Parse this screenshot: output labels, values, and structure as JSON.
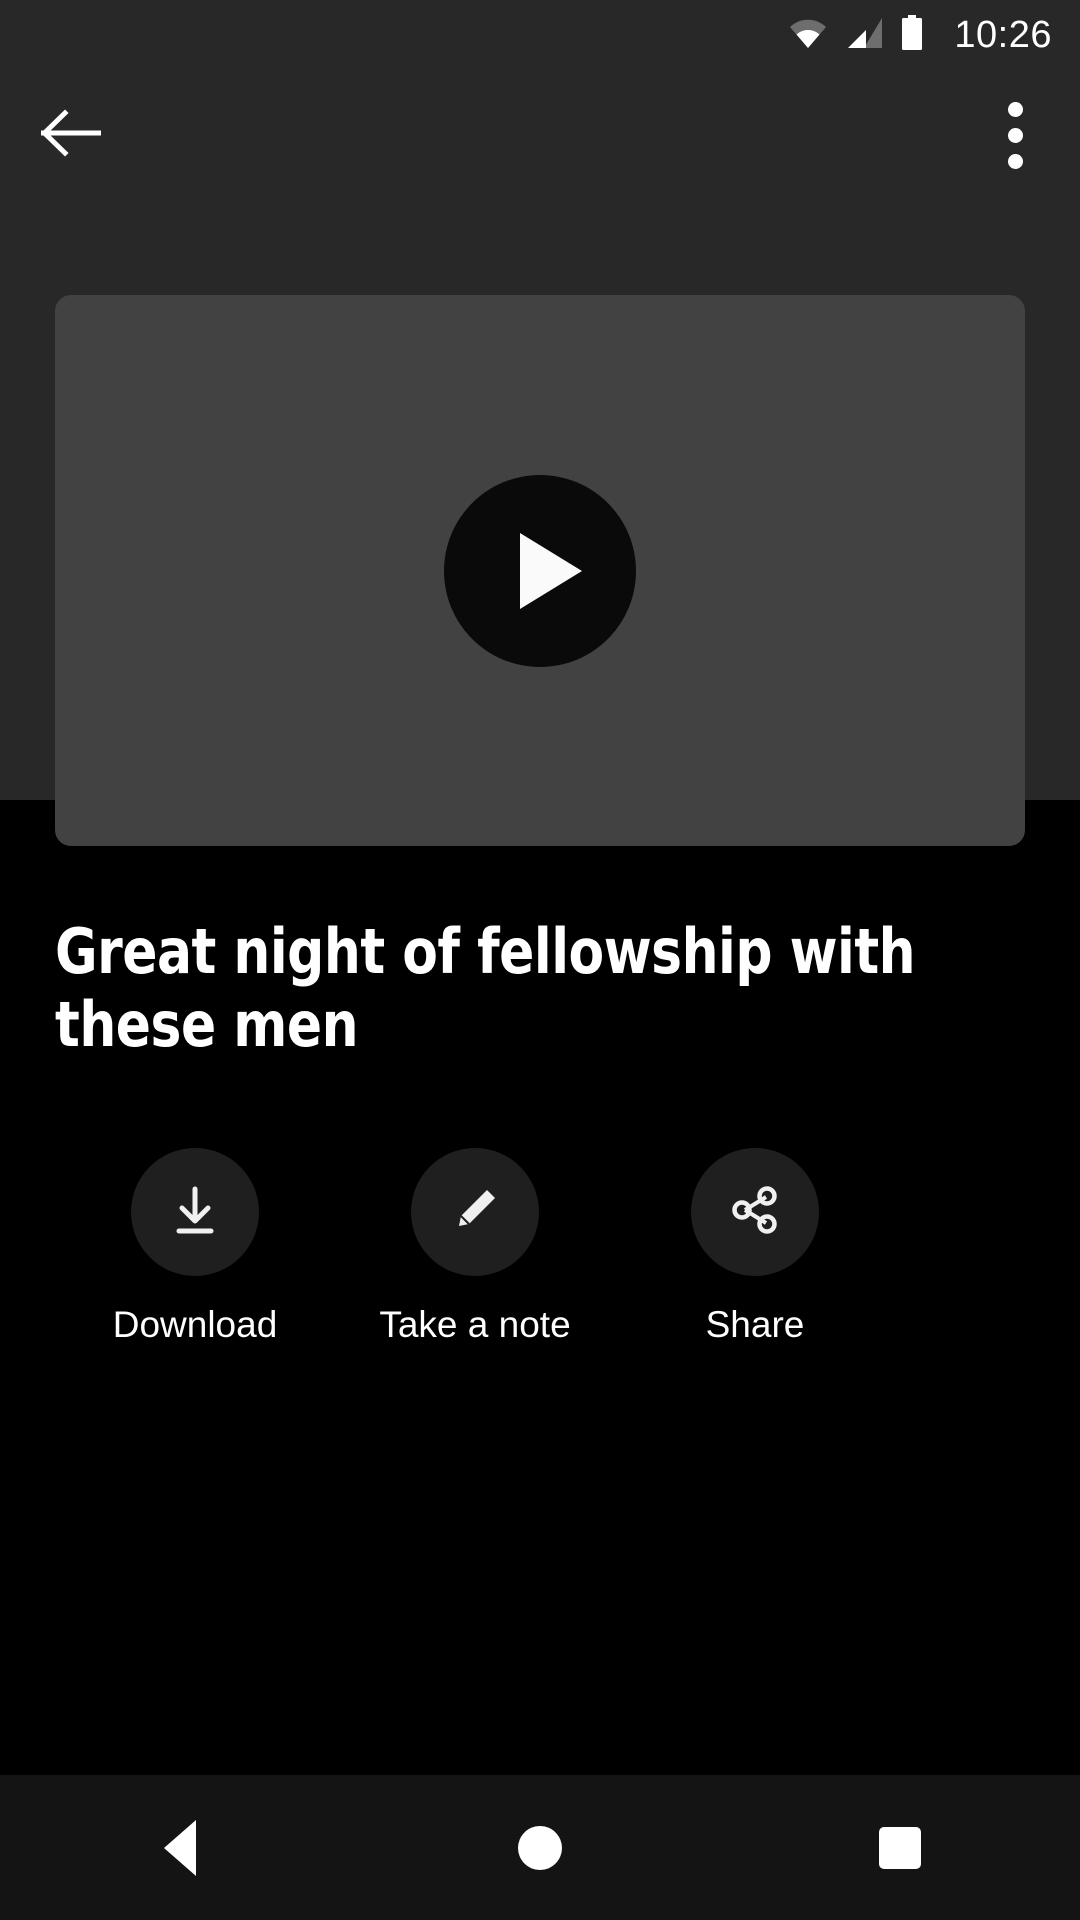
{
  "status_bar": {
    "time": "10:26",
    "icons": [
      "wifi-icon",
      "cellular-signal-icon",
      "battery-icon"
    ]
  },
  "app_bar": {
    "back_icon": "arrow-left-icon",
    "overflow_icon": "more-vertical-icon"
  },
  "player": {
    "play_icon": "play-icon",
    "thumbnail_color": "#424242",
    "play_button_color": "#0a0a0a"
  },
  "content": {
    "title": "Great night of fellowship with these men"
  },
  "actions": [
    {
      "label": "Download",
      "icon": "download-icon"
    },
    {
      "label": "Take a note",
      "icon": "pencil-icon"
    },
    {
      "label": "Share",
      "icon": "share-icon"
    }
  ],
  "nav_bar": {
    "back_icon": "nav-back-triangle-icon",
    "home_icon": "nav-home-circle-icon",
    "recents_icon": "nav-recents-square-icon"
  },
  "colors": {
    "top_background": "#282828",
    "page_background": "#000000",
    "nav_background": "#141414",
    "text": "#ffffff"
  }
}
